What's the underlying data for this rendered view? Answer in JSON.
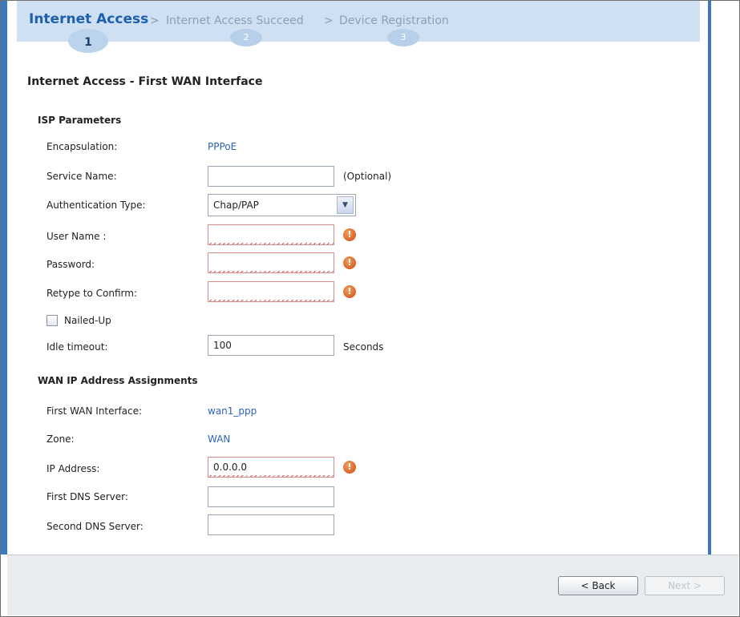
{
  "wizard": {
    "steps": [
      {
        "label": "Internet Access",
        "num": "1"
      },
      {
        "label": "Internet Access Succeed",
        "num": "2"
      },
      {
        "label": "Device Registration",
        "num": "3"
      }
    ],
    "separator": ">"
  },
  "page_title": "Internet Access - First WAN Interface",
  "isp": {
    "section_title": "ISP Parameters",
    "encapsulation_label": "Encapsulation:",
    "encapsulation_value": "PPPoE",
    "service_name_label": "Service Name:",
    "service_name_value": "",
    "service_name_note": "(Optional)",
    "auth_type_label": "Authentication Type:",
    "auth_type_value": "Chap/PAP",
    "user_name_label": "User Name :",
    "user_name_value": "",
    "password_label": "Password:",
    "password_value": "",
    "retype_label": "Retype to Confirm:",
    "retype_value": "",
    "nailed_up_label": "Nailed-Up",
    "idle_timeout_label": "Idle timeout:",
    "idle_timeout_value": "100",
    "idle_timeout_unit": "Seconds",
    "error_icon_text": "!"
  },
  "wan": {
    "section_title": "WAN IP Address Assignments",
    "first_wan_label": "First WAN Interface:",
    "first_wan_value": "wan1_ppp",
    "zone_label": "Zone:",
    "zone_value": "WAN",
    "ip_label": "IP Address:",
    "ip_value": "0.0.0.0",
    "dns1_label": "First DNS Server:",
    "dns1_value": "",
    "dns2_label": "Second DNS Server:",
    "dns2_value": ""
  },
  "footer": {
    "back_label": "< Back",
    "next_label": "Next >"
  },
  "colors": {
    "accent": "#3b78c2",
    "link_value": "#2a64b2",
    "error": "#d04810"
  }
}
